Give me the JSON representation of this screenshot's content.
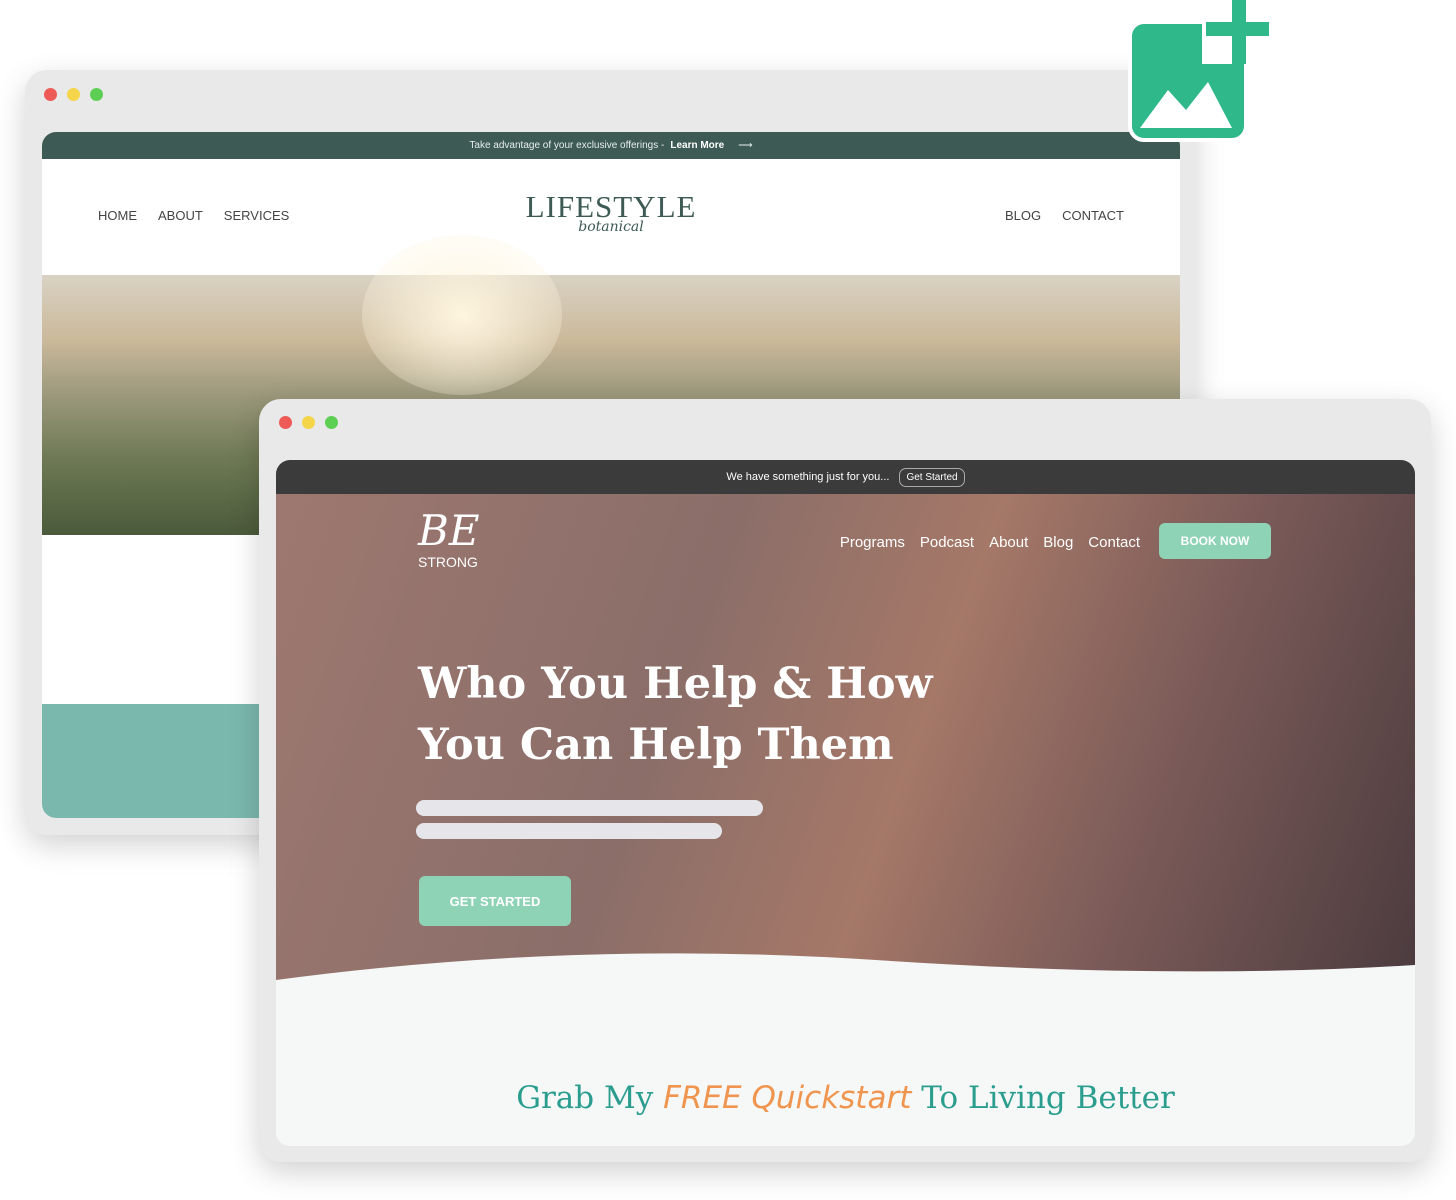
{
  "colors": {
    "accent": "#8fd3b6",
    "icon": "#2fb98a",
    "dark_teal": "#3d5a54",
    "orange": "#f0954f"
  },
  "icons": {
    "add_image": "add-image-icon"
  },
  "lifestyle": {
    "announcement": "Take advantage of your exclusive offerings  -",
    "announcement_link": "Learn More",
    "arrow": "⟶",
    "nav_left": [
      "HOME",
      "ABOUT",
      "SERVICES"
    ],
    "nav_right": [
      "BLOG",
      "CONTACT"
    ],
    "logo_main": "LIFESTYLE",
    "logo_sub": "botanical"
  },
  "bestrong": {
    "announcement": "We have something just for you...",
    "announcement_button": "Get Started",
    "logo_main": "BE",
    "logo_sub": "STRONG",
    "nav": [
      "Programs",
      "Podcast",
      "About",
      "Blog",
      "Contact"
    ],
    "book_button": "BOOK NOW",
    "headline": "Who You Help & How You Can Help Them",
    "cta": "GET STARTED",
    "section_title_1": "Grab My",
    "section_title_free": "FREE",
    "section_title_quick": "Quickstart",
    "section_title_2": "To Living Better"
  }
}
